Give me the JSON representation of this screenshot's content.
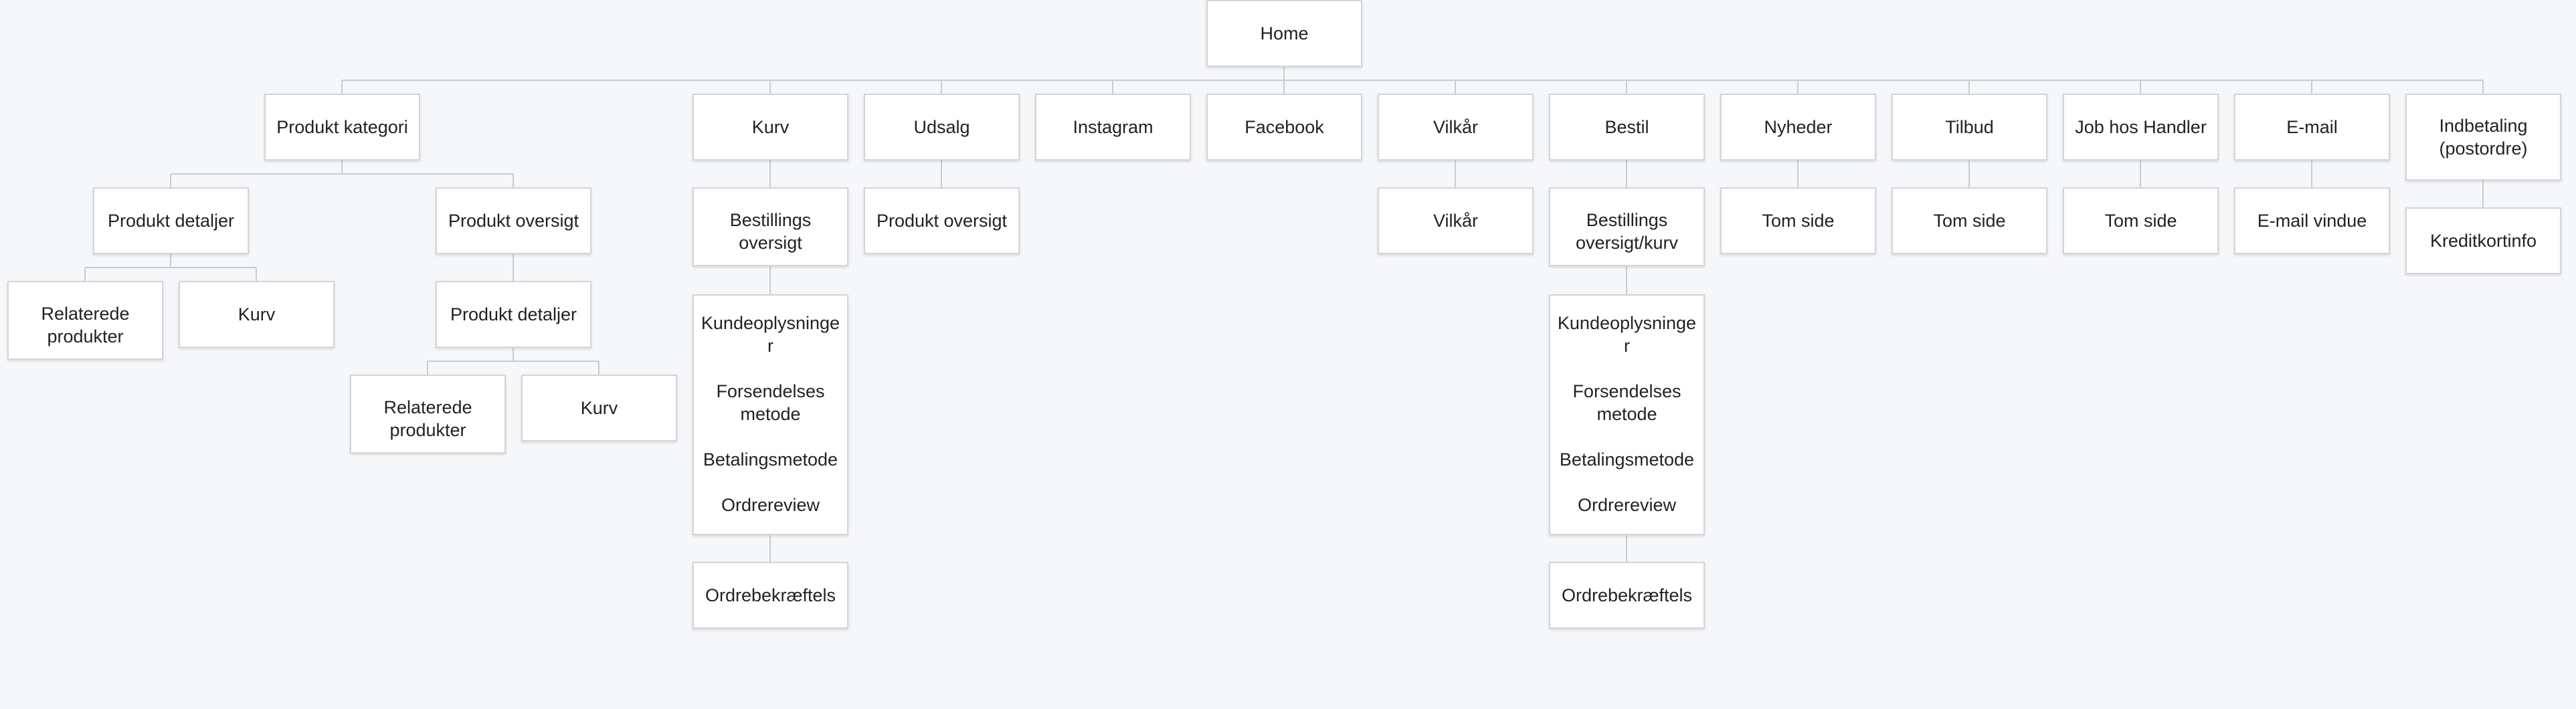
{
  "sitemap": {
    "nodes": {
      "home": "Home",
      "produkt_kategori": "Produkt kategori",
      "kurv": "Kurv",
      "udsalg": "Udsalg",
      "instagram": "Instagram",
      "facebook": "Facebook",
      "vilkaar": "Vilkår",
      "bestil": "Bestil",
      "nyheder": "Nyheder",
      "tilbud": "Tilbud",
      "job": "Job hos Handler",
      "email": "E-mail",
      "indbetaling": "Indbetaling\n(postordre)",
      "pk_produkt_detaljer": "Produkt detaljer",
      "pk_produkt_oversigt": "Produkt oversigt",
      "pk_relaterede": "Relaterede\nprodukter",
      "pk_kurv": "Kurv",
      "po_produkt_detaljer": "Produkt detaljer",
      "po_relaterede": "Relaterede\nprodukter",
      "po_kurv": "Kurv",
      "kurv_bestillings": "Bestillings\noversigt",
      "kurv_steps": "Kundeoplysninge\nr\n\nForsendelses\nmetode\n\nBetalingsmetode\n\nOrdrereview",
      "kurv_ordre": "Ordrebekræftels",
      "udsalg_oversigt": "Produkt oversigt",
      "vilkaar_child": "Vilkår",
      "bestil_bestillings": "Bestillings\noversigt/kurv",
      "bestil_steps": "Kundeoplysninge\nr\n\nForsendelses\nmetode\n\nBetalingsmetode\n\nOrdrereview",
      "bestil_ordre": "Ordrebekræftels",
      "nyheder_tom": "Tom side",
      "tilbud_tom": "Tom side",
      "job_tom": "Tom side",
      "email_vindue": "E-mail vindue",
      "kreditkortinfo": "Kreditkortinfo"
    }
  }
}
